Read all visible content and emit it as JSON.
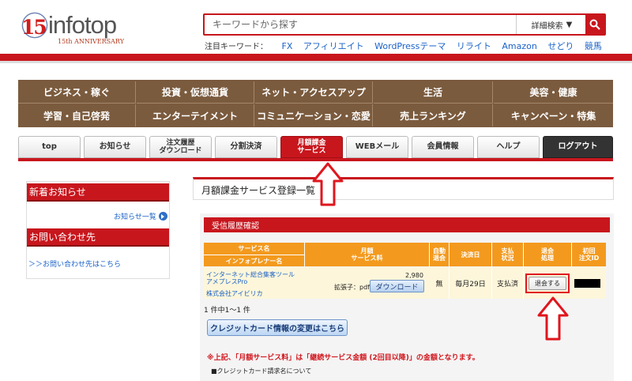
{
  "header": {
    "logo_number": "15",
    "logo_word": "infotop",
    "logo_anniversary": "15th ANNIVERSARY",
    "search_placeholder": "キーワードから探す",
    "detail_search_label": "詳細検索",
    "keyword_label": "注目キーワード：",
    "keywords": [
      "FX",
      "アフィリエイト",
      "WordPressテーマ",
      "リライト",
      "Amazon",
      "せどり",
      "競馬"
    ]
  },
  "categories": [
    [
      "ビジネス・稼ぐ",
      "投資・仮想通貨",
      "ネット・アクセスアップ",
      "生活",
      "美容・健康"
    ],
    [
      "学習・自己啓発",
      "エンターテイメント",
      "コミュニケーション・恋愛",
      "売上ランキング",
      "キャンペーン・特集"
    ]
  ],
  "tabs": [
    {
      "label": "top"
    },
    {
      "label": "お知らせ"
    },
    {
      "label": "注文履歴\nダウンロード"
    },
    {
      "label": "分割決済"
    },
    {
      "label": "月額課金\nサービス"
    },
    {
      "label": "WEBメール"
    },
    {
      "label": "会員情報"
    },
    {
      "label": "ヘルプ"
    },
    {
      "label": "ログアウト"
    }
  ],
  "sidebar": {
    "news_head": "新着お知らせ",
    "news_list_link": "お知らせ一覧",
    "contact_head": "お問い合わせ先",
    "contact_link": "＞＞お問い合わせ先はこちら"
  },
  "main": {
    "page_title": "月額課金サービス登録一覧",
    "history_title": "受信履歴確認",
    "columns": {
      "service": "サービス名",
      "infopreneur": "インフォプレナー名",
      "monthly_fee": "月額\nサービス料",
      "auto_cancel": "自動\n退会",
      "payment_day": "決済日",
      "payment_status": "支払\n状況",
      "cancel_process": "退会\n処理",
      "first_order_id": "初回\n注文ID"
    },
    "row": {
      "service_name": "インターネット総合集客ツール アメプレスPro",
      "infopreneur": "株式会社アイビリカ",
      "amount": "2,980",
      "extension": "拡張子：pdf",
      "download_label": "ダウンロード",
      "auto_cancel": "無",
      "payment_day": "毎月29日",
      "payment_status": "支払済",
      "cancel_label": "退会する"
    },
    "count_text": "1 件中1～1 件",
    "card_button": "クレジットカード情報の変更はこちら",
    "note": "※上記、「月額サービス料」は「継続サービス金額 (2回目以降)」の金額となります。",
    "billing_note": "■クレジットカード請求名について"
  },
  "colors": {
    "brand_red": "#c8161d",
    "nav_brown": "#7b5b3e",
    "table_orange": "#f39a1e",
    "link_blue": "#1a62c7"
  }
}
